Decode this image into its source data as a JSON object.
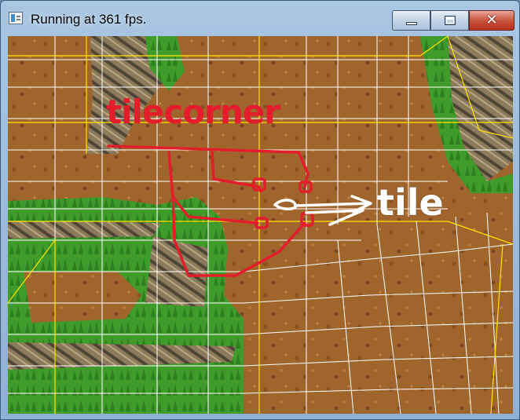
{
  "window": {
    "title": "Running at 361 fps.",
    "controls": {
      "minimize_glyph": "—",
      "maximize_glyph": "",
      "close_glyph": "✕"
    }
  },
  "scene": {
    "annotations": {
      "tilecorner_label": "tilecorner",
      "tile_label": "tile"
    },
    "colors": {
      "dirt": "#a0652c",
      "grass": "#3f9c2a",
      "cliff": "#8c7a5c",
      "grid_lines": "#ffffff",
      "cell_boundaries": "#ffe500",
      "annotation_red": "#e31d2a",
      "annotation_white": "#ffffff"
    }
  }
}
